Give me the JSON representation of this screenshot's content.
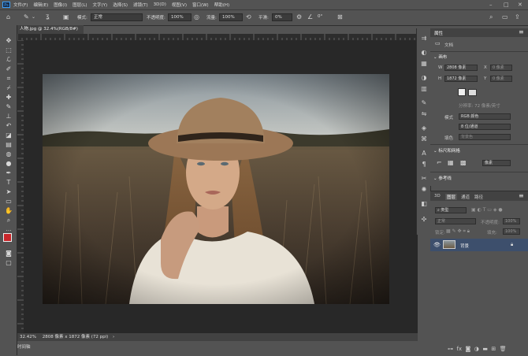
{
  "app": {
    "logo": "Ps"
  },
  "menu": [
    "文件(F)",
    "编辑(E)",
    "图像(I)",
    "图层(L)",
    "文字(Y)",
    "选择(S)",
    "滤镜(T)",
    "3D(D)",
    "视图(V)",
    "窗口(W)",
    "帮助(H)"
  ],
  "options": {
    "mode_label": "模式:",
    "mode_value": "正常",
    "opacity_label": "不透明度:",
    "opacity_value": "100%",
    "flow_label": "流量:",
    "flow_value": "100%",
    "smooth_label": "平滑:",
    "smooth_value": "0%",
    "angle_value": "0°"
  },
  "document": {
    "tab_title": "人物.jpg @ 32.4%(RGB/8#)",
    "zoom": "32.42%",
    "dimensions": "2808 像素 x 1872 像素 (72 ppi)"
  },
  "timeline_label": "时间轴",
  "properties": {
    "tab": "属性",
    "doc_label": "文档",
    "canvas_section": "画布",
    "w_label": "W",
    "w_value": "2808 像素",
    "h_label": "H",
    "h_value": "1872 像素",
    "x_label": "X",
    "x_placeholder": "0 像素",
    "y_label": "Y",
    "y_placeholder": "0 像素",
    "resolution": "分辨率: 72 像素/英寸",
    "mode_label": "模式",
    "mode_value": "RGB 颜色",
    "depth_value": "8 位/通道",
    "fill_label": "填色",
    "fill_value": "背景色",
    "rulers_section": "标尺和网格",
    "units_value": "像素",
    "guides_section": "参考线"
  },
  "layers_panel": {
    "tabs": [
      "3D",
      "图层",
      "通道",
      "路径"
    ],
    "kind_label": "类型",
    "blend_value": "正常",
    "opacity_label": "不透明度:",
    "opacity_value": "100%",
    "lock_label": "锁定:",
    "fill_label": "填充:",
    "fill_value": "100%",
    "layer_name": "背景"
  }
}
